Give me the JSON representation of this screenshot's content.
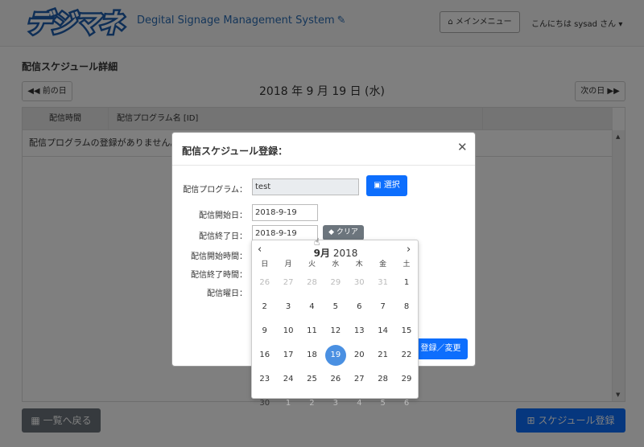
{
  "header": {
    "logo_text": "デジマネ",
    "system_title": "Degital Signage Management System",
    "menu_button": "メインメニュー",
    "user_greeting": "こんにちは sysad さん"
  },
  "page": {
    "title": "配信スケジュール詳細",
    "prev_day": "前の日",
    "next_day": "次の日",
    "date_display": "2018 年 9 月 19 日 (水)",
    "table_headers": [
      "配信時間",
      "配信プログラム名 [ID]"
    ],
    "empty_message": "配信プログラムの登録がありません。",
    "back_button": "一覧へ戻る",
    "register_button": "スケジュール登録"
  },
  "modal": {
    "title": "配信スケジュール登録：",
    "fields": {
      "program_label": "配信プログラム：",
      "program_value": "test",
      "select_button": "選択",
      "start_date_label": "配信開始日：",
      "start_date_value": "2018-9-19",
      "end_date_label": "配信終了日：",
      "end_date_value": "2018-9-19",
      "clear_button": "クリア",
      "start_time_label": "配信開始時間：",
      "end_time_label": "配信終了時間：",
      "weekday_label": "配信曜日："
    },
    "save_button": "登録／変更"
  },
  "calendar": {
    "month": "9月",
    "year": "2018",
    "weekdays": [
      "日",
      "月",
      "火",
      "水",
      "木",
      "金",
      "土"
    ],
    "weeks": [
      [
        "26",
        "27",
        "28",
        "29",
        "30",
        "31",
        "1"
      ],
      [
        "2",
        "3",
        "4",
        "5",
        "6",
        "7",
        "8"
      ],
      [
        "9",
        "10",
        "11",
        "12",
        "13",
        "14",
        "15"
      ],
      [
        "16",
        "17",
        "18",
        "19",
        "20",
        "21",
        "22"
      ],
      [
        "23",
        "24",
        "25",
        "26",
        "27",
        "28",
        "29"
      ],
      [
        "30",
        "1",
        "2",
        "3",
        "4",
        "5",
        "6"
      ]
    ],
    "selected_day": "19"
  },
  "colors": {
    "primary": "#0d6efd",
    "secondary": "#6c757d",
    "selected_day": "#4a90e2",
    "title_blue": "#2a6db5"
  }
}
